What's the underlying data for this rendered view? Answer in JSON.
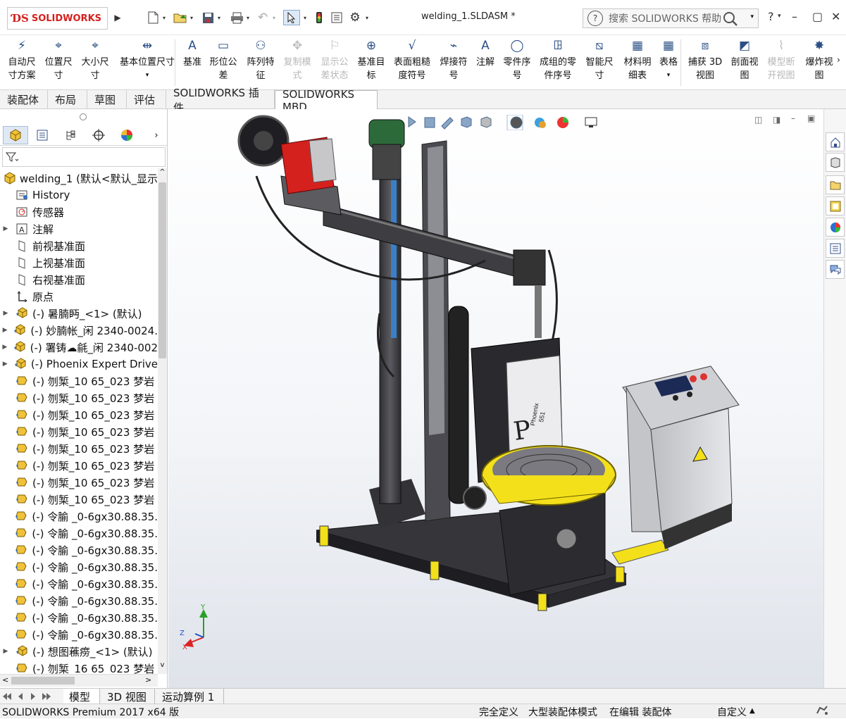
{
  "app": {
    "brand": "SOLIDWORKS",
    "doc_title": "welding_1.SLDASM *",
    "search_placeholder": "搜索 SOLIDWORKS 帮助"
  },
  "ribbon": [
    {
      "label": "自动尺\n寸方案",
      "enabled": true,
      "icon": "auto-dimension-icon"
    },
    {
      "label": "位置尺\n寸",
      "enabled": true,
      "icon": "location-dimension-icon"
    },
    {
      "label": "大小尺\n寸",
      "enabled": true,
      "icon": "size-dimension-icon"
    },
    {
      "label": "基本位置尺寸",
      "enabled": true,
      "icon": "basic-location-dimension-icon"
    },
    {
      "label": "基准",
      "enabled": true,
      "icon": "datum-icon"
    },
    {
      "label": "形位公\n差",
      "enabled": true,
      "icon": "geometric-tolerance-icon"
    },
    {
      "label": "阵列特\n征",
      "enabled": true,
      "icon": "pattern-feature-icon"
    },
    {
      "label": "复制模\n式",
      "enabled": false,
      "icon": "copy-scheme-icon"
    },
    {
      "label": "显示公\n差状态",
      "enabled": false,
      "icon": "show-tolerance-status-icon"
    },
    {
      "label": "基准目\n标",
      "enabled": true,
      "icon": "datum-target-icon"
    },
    {
      "label": "表面粗糙\n度符号",
      "enabled": true,
      "icon": "surface-finish-icon"
    },
    {
      "label": "焊接符\n号",
      "enabled": true,
      "icon": "weld-symbol-icon"
    },
    {
      "label": "注解",
      "enabled": true,
      "icon": "note-icon"
    },
    {
      "label": "零件序\n号",
      "enabled": true,
      "icon": "balloon-icon"
    },
    {
      "label": "成组的零\n件序号",
      "enabled": true,
      "icon": "stacked-balloon-icon"
    },
    {
      "label": "智能尺\n寸",
      "enabled": true,
      "icon": "smart-dimension-icon"
    },
    {
      "label": "材料明\n细表",
      "enabled": true,
      "icon": "bom-icon"
    },
    {
      "label": "表格",
      "enabled": true,
      "icon": "table-icon"
    },
    {
      "label": "捕获 3D\n视图",
      "enabled": true,
      "icon": "capture-3d-view-icon"
    },
    {
      "label": "剖面视\n图",
      "enabled": true,
      "icon": "section-view-icon"
    },
    {
      "label": "模型断\n开视图",
      "enabled": false,
      "icon": "model-break-view-icon"
    },
    {
      "label": "爆炸视\n图",
      "enabled": true,
      "icon": "exploded-view-icon"
    }
  ],
  "tabs": [
    "装配体",
    "布局",
    "草图",
    "评估",
    "SOLIDWORKS 插件",
    "SOLIDWORKS MBD"
  ],
  "active_tab": "SOLIDWORKS MBD",
  "tree": [
    {
      "label": "welding_1  (默认<默认_显示",
      "type": "root"
    },
    {
      "label": "History",
      "type": "history"
    },
    {
      "label": "传感器",
      "type": "sensor"
    },
    {
      "label": "注解",
      "type": "annotation",
      "expand": true
    },
    {
      "label": "前视基准面",
      "type": "plane"
    },
    {
      "label": "上视基准面",
      "type": "plane"
    },
    {
      "label": "右视基准面",
      "type": "plane"
    },
    {
      "label": "原点",
      "type": "origin"
    },
    {
      "label": "(-) 暑腩眄_<1> (默认)",
      "type": "subassembly",
      "expand": true
    },
    {
      "label": "(-) 妙腩帐_闲 2340-0024.",
      "type": "subassembly",
      "expand": true
    },
    {
      "label": "(-) 署铸☁毹_闲 2340-002",
      "type": "subassembly",
      "expand": true
    },
    {
      "label": "(-) Phoenix Expert Drive",
      "type": "subassembly",
      "expand": true
    },
    {
      "label": "(-) 刎椠_10 65_023 梦岩",
      "type": "part"
    },
    {
      "label": "(-) 刎椠_10 65_023 梦岩",
      "type": "part"
    },
    {
      "label": "(-) 刎椠_10 65_023 梦岩",
      "type": "part"
    },
    {
      "label": "(-) 刎椠_10 65_023 梦岩",
      "type": "part"
    },
    {
      "label": "(-) 刎椠_10 65_023 梦岩",
      "type": "part"
    },
    {
      "label": "(-) 刎椠_10 65_023 梦岩",
      "type": "part"
    },
    {
      "label": "(-) 刎椠_10 65_023 梦岩",
      "type": "part"
    },
    {
      "label": "(-) 刎椠_10 65_023 梦岩",
      "type": "part"
    },
    {
      "label": "(-) 令腧 _0-6gx30.88.35.",
      "type": "part"
    },
    {
      "label": "(-) 令腧 _0-6gx30.88.35.",
      "type": "part"
    },
    {
      "label": "(-) 令腧 _0-6gx30.88.35.",
      "type": "part"
    },
    {
      "label": "(-) 令腧 _0-6gx30.88.35.",
      "type": "part"
    },
    {
      "label": "(-) 令腧 _0-6gx30.88.35.",
      "type": "part"
    },
    {
      "label": "(-) 令腧 _0-6gx30.88.35.",
      "type": "part"
    },
    {
      "label": "(-) 令腧 _0-6gx30.88.35.",
      "type": "part"
    },
    {
      "label": "(-) 令腧 _0-6gx30.88.35.",
      "type": "part"
    },
    {
      "label": "(-) 想图藮痨_<1> (默认)",
      "type": "subassembly",
      "expand": true
    },
    {
      "label": "(-) 刎椠_16 65_023 梦岩",
      "type": "part"
    }
  ],
  "bottom_tabs": [
    "模型",
    "3D 视图",
    "运动算例 1"
  ],
  "status": {
    "product": "SOLIDWORKS Premium 2017 x64 版",
    "defined": "完全定义",
    "mode": "大型装配体模式",
    "editing": "在编辑 装配体",
    "custom": "自定义"
  },
  "triad": {
    "x": "X",
    "y": "Y",
    "z": "Z"
  },
  "model_labels": {
    "welder_brand": "Phoenix",
    "welder_model": "551"
  },
  "colors": {
    "accent_red": "#d4211e",
    "selection_blue": "#0a64c8",
    "frame_gray": "#4a4a4e",
    "guard_yellow": "#f3e01a"
  }
}
